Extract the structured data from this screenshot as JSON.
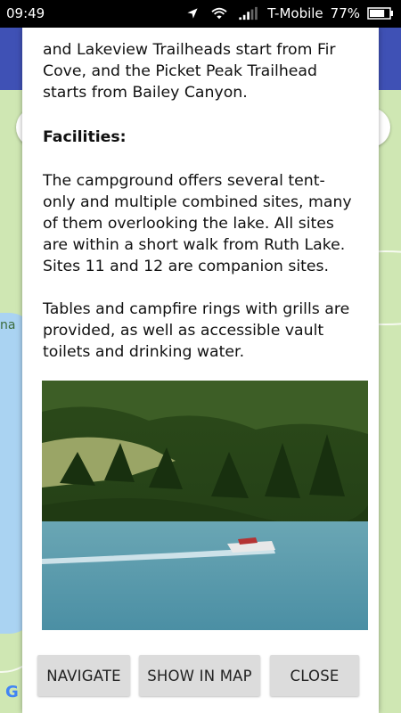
{
  "status_bar": {
    "time": "09:49",
    "carrier": "T-Mobile",
    "battery": "77%",
    "battery_level": 0.77
  },
  "map": {
    "label": "na",
    "google_logo": "G"
  },
  "dialog": {
    "paragraph_1": "and Lakeview Trailheads start from Fir Cove, and the Picket Peak Trailhead starts from Bailey Canyon.",
    "heading": "Facilities:",
    "paragraph_2": "The campground offers several tent-only and multiple combined sites, many of them overlooking the lake. All sites are within a short walk from Ruth Lake. Sites 11 and 12 are companion sites.",
    "paragraph_3": "Tables and campfire rings with grills are provided, as well as accessible vault toilets and drinking water.",
    "buttons": {
      "navigate": "NAVIGATE",
      "show_in_map": "SHOW IN MAP",
      "close": "CLOSE"
    }
  },
  "icons": [
    "location-arrow-icon",
    "wifi-icon",
    "signal-icon",
    "battery-icon",
    "google-g-icon"
  ]
}
